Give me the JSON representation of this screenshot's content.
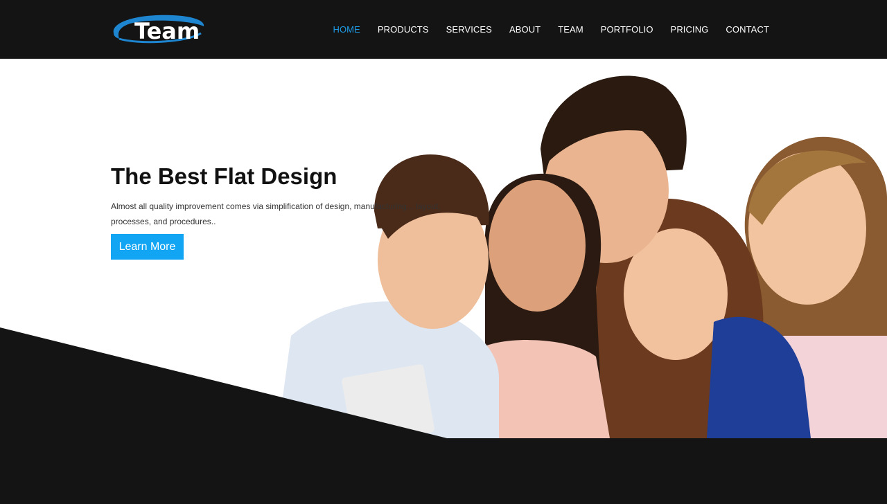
{
  "brand": {
    "logo_text": "Team"
  },
  "nav": {
    "items": [
      {
        "label": "HOME",
        "active": true
      },
      {
        "label": "PRODUCTS",
        "active": false
      },
      {
        "label": "SERVICES",
        "active": false
      },
      {
        "label": "ABOUT",
        "active": false
      },
      {
        "label": "TEAM",
        "active": false
      },
      {
        "label": "PORTFOLIO",
        "active": false
      },
      {
        "label": "PRICING",
        "active": false
      },
      {
        "label": "CONTACT",
        "active": false
      }
    ]
  },
  "hero": {
    "title": "The Best Flat Design",
    "text": "Almost all quality improvement comes via simplification of design, manufacturing... layout, processes, and procedures..",
    "button_label": "Learn More",
    "image_icon": "group-of-people-photo"
  },
  "colors": {
    "background": "#141414",
    "accent": "#1e9be6",
    "button": "#12a5f4",
    "hero_bg": "#ffffff",
    "title": "#111111"
  }
}
